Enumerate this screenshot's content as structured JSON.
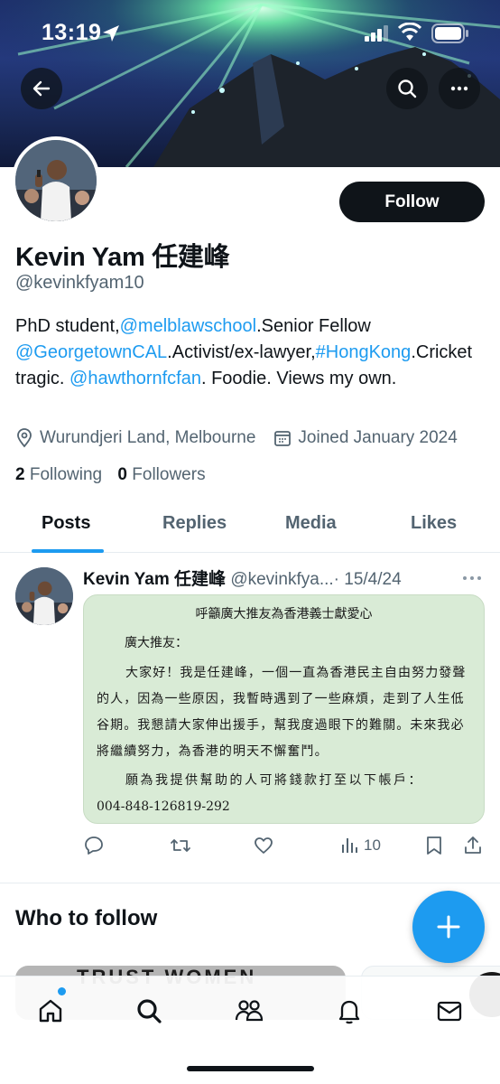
{
  "status_bar": {
    "time": "13:19"
  },
  "header": {
    "back_icon": "arrow-left-icon",
    "search_icon": "search-icon",
    "more_icon": "more-horizontal-icon"
  },
  "profile": {
    "follow_label": "Follow",
    "name": "Kevin Yam 任建峰",
    "handle": "@kevinkfyam10",
    "bio": {
      "t1": "PhD student,",
      "l1": "@melblawschool",
      "t2": ".Senior Fellow ",
      "l2": "@GeorgetownCAL",
      "t3": ".Activist/ex-lawyer,",
      "l3": "#HongKong",
      "t4": ".Cricket tragic. ",
      "l4": "@hawthornfcfan",
      "t5": ". Foodie. Views my own."
    },
    "location": "Wurundjeri Land, Melbourne",
    "joined": "Joined January 2024",
    "following_count": "2",
    "following_label": "Following",
    "followers_count": "0",
    "followers_label": "Followers"
  },
  "tabs": [
    {
      "label": "Posts",
      "active": true
    },
    {
      "label": "Replies"
    },
    {
      "label": "Media"
    },
    {
      "label": "Likes"
    }
  ],
  "post": {
    "author": "Kevin Yam 任建峰",
    "handle": "@kevinkfya...",
    "date": "· 15/4/24",
    "image_text": {
      "title": "呼籲廣大推友為香港義士獻愛心",
      "greeting": "廣大推友：",
      "body": "大家好！我是任建峰，一個一直為香港民主自由努力發聲的人，因為一些原因，我暫時遇到了一些麻煩，走到了人生低谷期。我懇請大家伸出援手，幫我度過眼下的難關。未來我必將繼續努力，為香港的明天不懈奮鬥。",
      "account_label": "願為我提供幫助的人可將錢款打至以下帳戶：",
      "account_number": "004-848-126819-292"
    },
    "views": "10"
  },
  "who_to_follow": {
    "title": "Who to follow",
    "card_text": "TRUST WOMEN"
  },
  "colors": {
    "accent": "#1d9bf0",
    "text": "#0f1419",
    "secondary": "#536471",
    "post_image_bg": "#d9ebd6"
  }
}
